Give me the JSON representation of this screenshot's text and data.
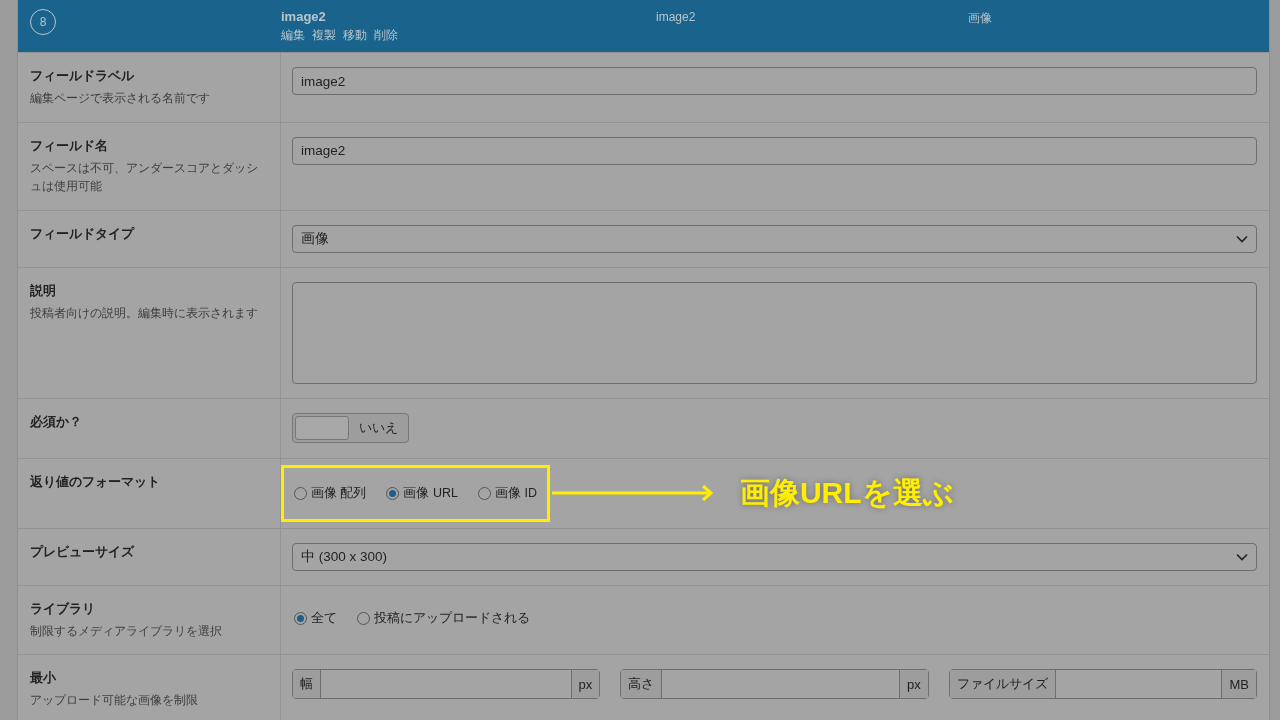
{
  "header": {
    "number": "8",
    "label": "image2",
    "actions": [
      "編集",
      "複製",
      "移動",
      "削除"
    ],
    "name": "image2",
    "type": "画像"
  },
  "rows": [
    {
      "kind": "text",
      "label": "フィールドラベル",
      "description": "編集ページで表示される名前です",
      "value": "image2"
    },
    {
      "kind": "text",
      "label": "フィールド名",
      "description": "スペースは不可、アンダースコアとダッシュは使用可能",
      "value": "image2"
    },
    {
      "kind": "select",
      "label": "フィールドタイプ",
      "value": "画像"
    },
    {
      "kind": "textarea",
      "label": "説明",
      "description": "投稿者向けの説明。編集時に表示されます"
    },
    {
      "kind": "toggle",
      "label": "必須か？",
      "on": false,
      "text": "いいえ"
    },
    {
      "kind": "radio",
      "label": "返り値のフォーマット",
      "highlighted": true,
      "options": [
        {
          "label": "画像 配列",
          "selected": false
        },
        {
          "label": "画像 URL",
          "selected": true
        },
        {
          "label": "画像 ID",
          "selected": false
        }
      ],
      "note": "画像URLを選ぶ"
    },
    {
      "kind": "select",
      "label": "プレビューサイズ",
      "value": "中 (300 x 300)"
    },
    {
      "kind": "radio",
      "label": "ライブラリ",
      "description": "制限するメディアライブラリを選択",
      "highlighted": false,
      "options": [
        {
          "label": "全て",
          "selected": true
        },
        {
          "label": "投稿にアップロードされる",
          "selected": false
        }
      ]
    },
    {
      "kind": "dimensions",
      "label": "最小",
      "description": "アップロード可能な画像を制限",
      "inputs": [
        {
          "prepend": "幅",
          "append": "px"
        },
        {
          "prepend": "高さ",
          "append": "px"
        },
        {
          "prepend": "ファイルサイズ",
          "append": "MB"
        }
      ]
    }
  ]
}
